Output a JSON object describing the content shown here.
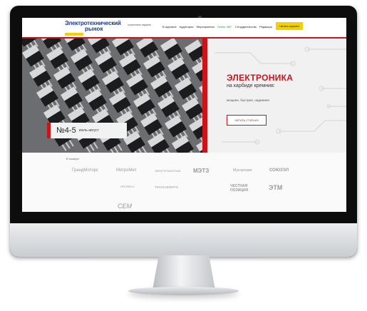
{
  "header": {
    "logo_line1": "Электротехнический",
    "logo_line2": "рынок",
    "tagline": "отраслевое издание",
    "nav": [
      "В журнале",
      "Аудитория",
      "Мероприятия",
      "Online 360°",
      "Сотрудничество",
      "Редакция"
    ],
    "read_button": "Читать журнал"
  },
  "hero": {
    "issue_number": "№4-5",
    "issue_months": "июль-август",
    "title": "ЭЛЕКТРОНИКА",
    "subtitle": "на карбиде кремния:",
    "description": "мощнее, быстрее, надежнее",
    "cta": "ЧИТАТЬ СТАТЬЮ!"
  },
  "partners": {
    "title": "В номере:",
    "logos": [
      "ГрандМоторс",
      "МетроМет",
      "ЭЛЕКТРОМОНТАЖ",
      "МЭТЗ",
      "Мусоргские",
      "СОЮЗЭЛ",
      "ПРОФЕСС",
      "ТРАНСЭНЕРГО",
      "ЧЕСТНАЯ ПОЗИЦИЯ",
      "ЭТМ",
      "CEM"
    ]
  },
  "colors": {
    "accent_red": "#c8141a",
    "accent_yellow": "#f4d000",
    "logo_blue": "#1a3a8c"
  }
}
